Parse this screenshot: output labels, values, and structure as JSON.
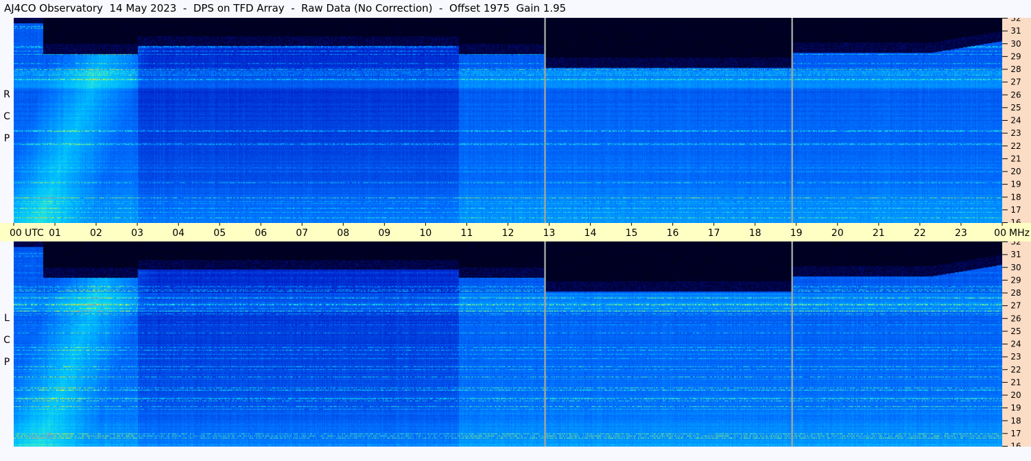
{
  "title": "AJ4CO Observatory  14 May 2023  -  DPS on TFD Array  -  Raw Data (No Correction)  -  Offset 1975  Gain 1.95",
  "colors": {
    "background": "#f8f8ff",
    "time_axis_bg": "#ffffc4",
    "freq_axis_bg": "#fbdcc4",
    "marker_line": "#9aa5a0"
  },
  "chart_data": [
    {
      "type": "heatmap",
      "panel": "RCP",
      "ylabel": "R C P",
      "x": {
        "unit_label": "UTC",
        "range": [
          0,
          24
        ],
        "tick_labels": [
          "00",
          "01",
          "02",
          "03",
          "04",
          "05",
          "06",
          "07",
          "08",
          "09",
          "10",
          "11",
          "12",
          "13",
          "14",
          "15",
          "16",
          "17",
          "18",
          "19",
          "20",
          "21",
          "22",
          "23",
          "00"
        ]
      },
      "y": {
        "unit_label": "MHz",
        "range": [
          16,
          32
        ],
        "tick_labels": [
          "16",
          "17",
          "18",
          "19",
          "20",
          "21",
          "22",
          "23",
          "24",
          "25",
          "26",
          "27",
          "28",
          "29",
          "30",
          "31",
          "32"
        ]
      },
      "marker_times": [
        12.9,
        18.9
      ]
    },
    {
      "type": "heatmap",
      "panel": "LCP",
      "ylabel": "L C P",
      "x": {
        "unit_label": "UTC",
        "range": [
          0,
          24
        ],
        "tick_labels": [
          "00",
          "01",
          "02",
          "03",
          "04",
          "05",
          "06",
          "07",
          "08",
          "09",
          "10",
          "11",
          "12",
          "13",
          "14",
          "15",
          "16",
          "17",
          "18",
          "19",
          "20",
          "21",
          "22",
          "23",
          "00"
        ]
      },
      "y": {
        "unit_label": "MHz",
        "range": [
          16,
          32
        ],
        "tick_labels": [
          "16",
          "17",
          "18",
          "19",
          "20",
          "21",
          "22",
          "23",
          "24",
          "25",
          "26",
          "27",
          "28",
          "29",
          "30",
          "31",
          "32"
        ]
      },
      "marker_times": [
        12.9,
        18.9
      ]
    }
  ]
}
